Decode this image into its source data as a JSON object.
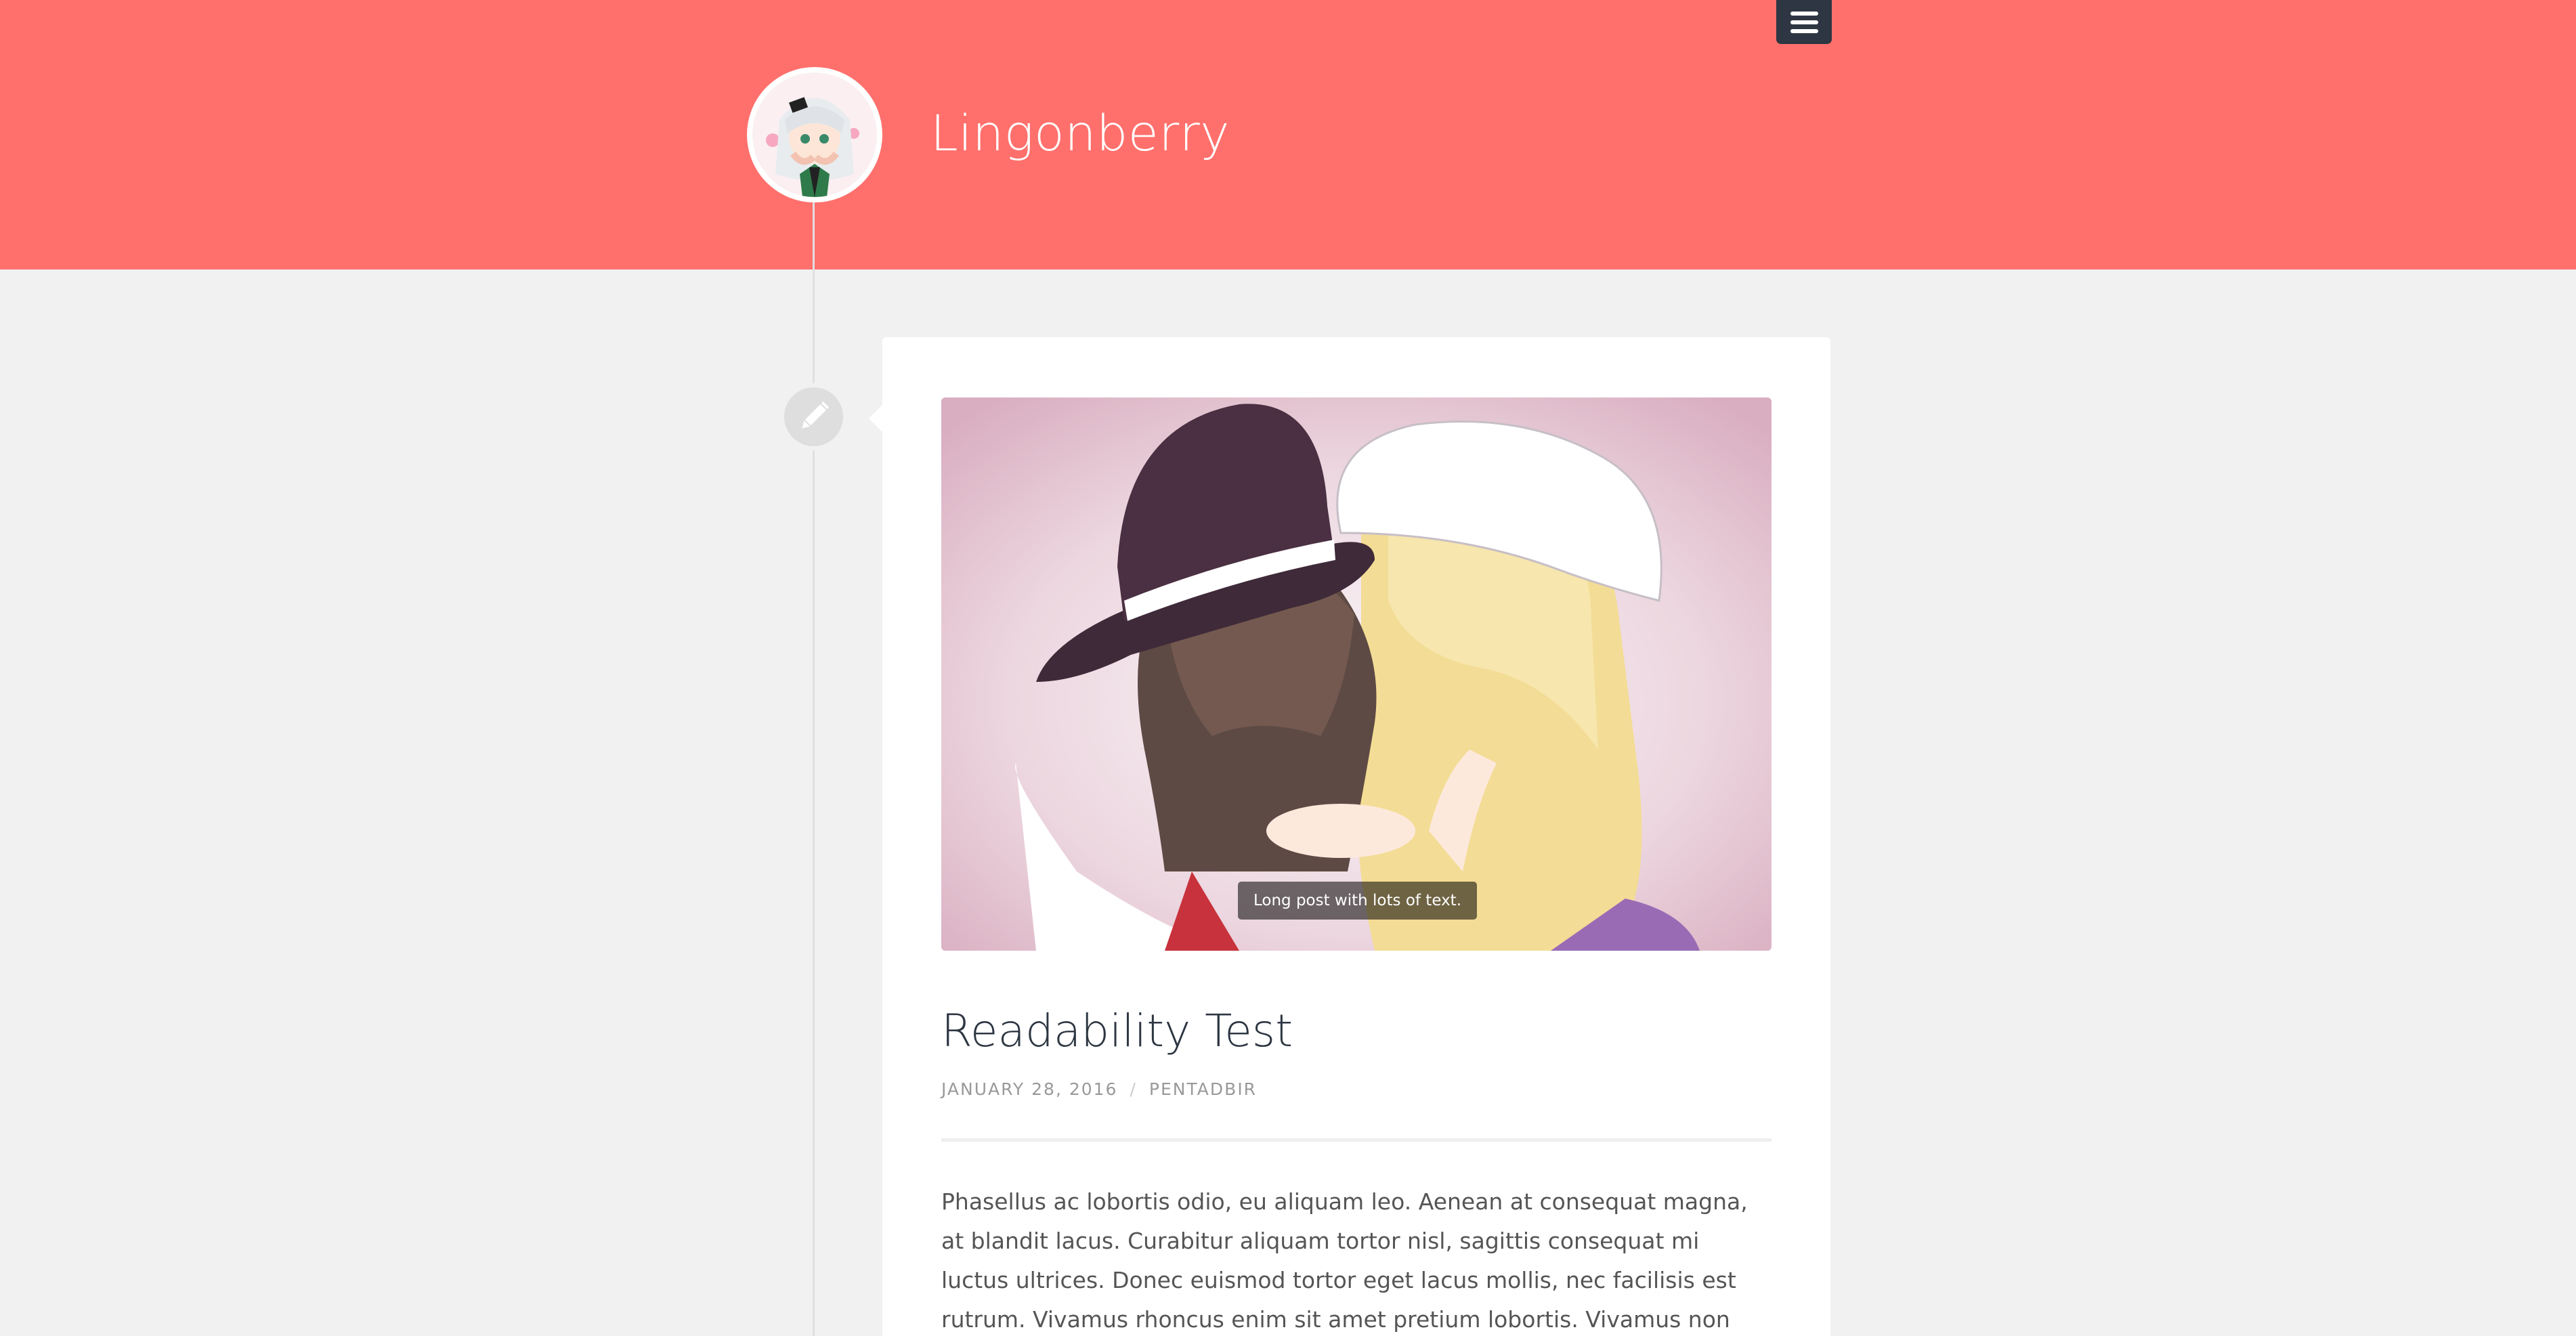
{
  "header": {
    "site_title": "Lingonberry",
    "background_color": "#ff706c",
    "menu_icon": "hamburger-menu-icon",
    "avatar_alt": "site-avatar"
  },
  "post": {
    "format_icon": "pencil-icon",
    "caption": "Long post with lots of text.",
    "title": "Readability Test",
    "date": "JANUARY 28, 2016",
    "meta_separator": "/",
    "author": "PENTADBIR",
    "body": "Phasellus ac lobortis odio, eu aliquam leo. Aenean at consequat magna, at blandit lacus. Curabitur aliquam tortor nisl, sagittis consequat mi luctus ultrices. Donec euismod tortor eget lacus mollis, nec facilisis est rutrum. Vivamus rhoncus enim sit amet pretium lobortis. Vivamus non aliquam ligula, nec pharetra ligula. Donec"
  }
}
